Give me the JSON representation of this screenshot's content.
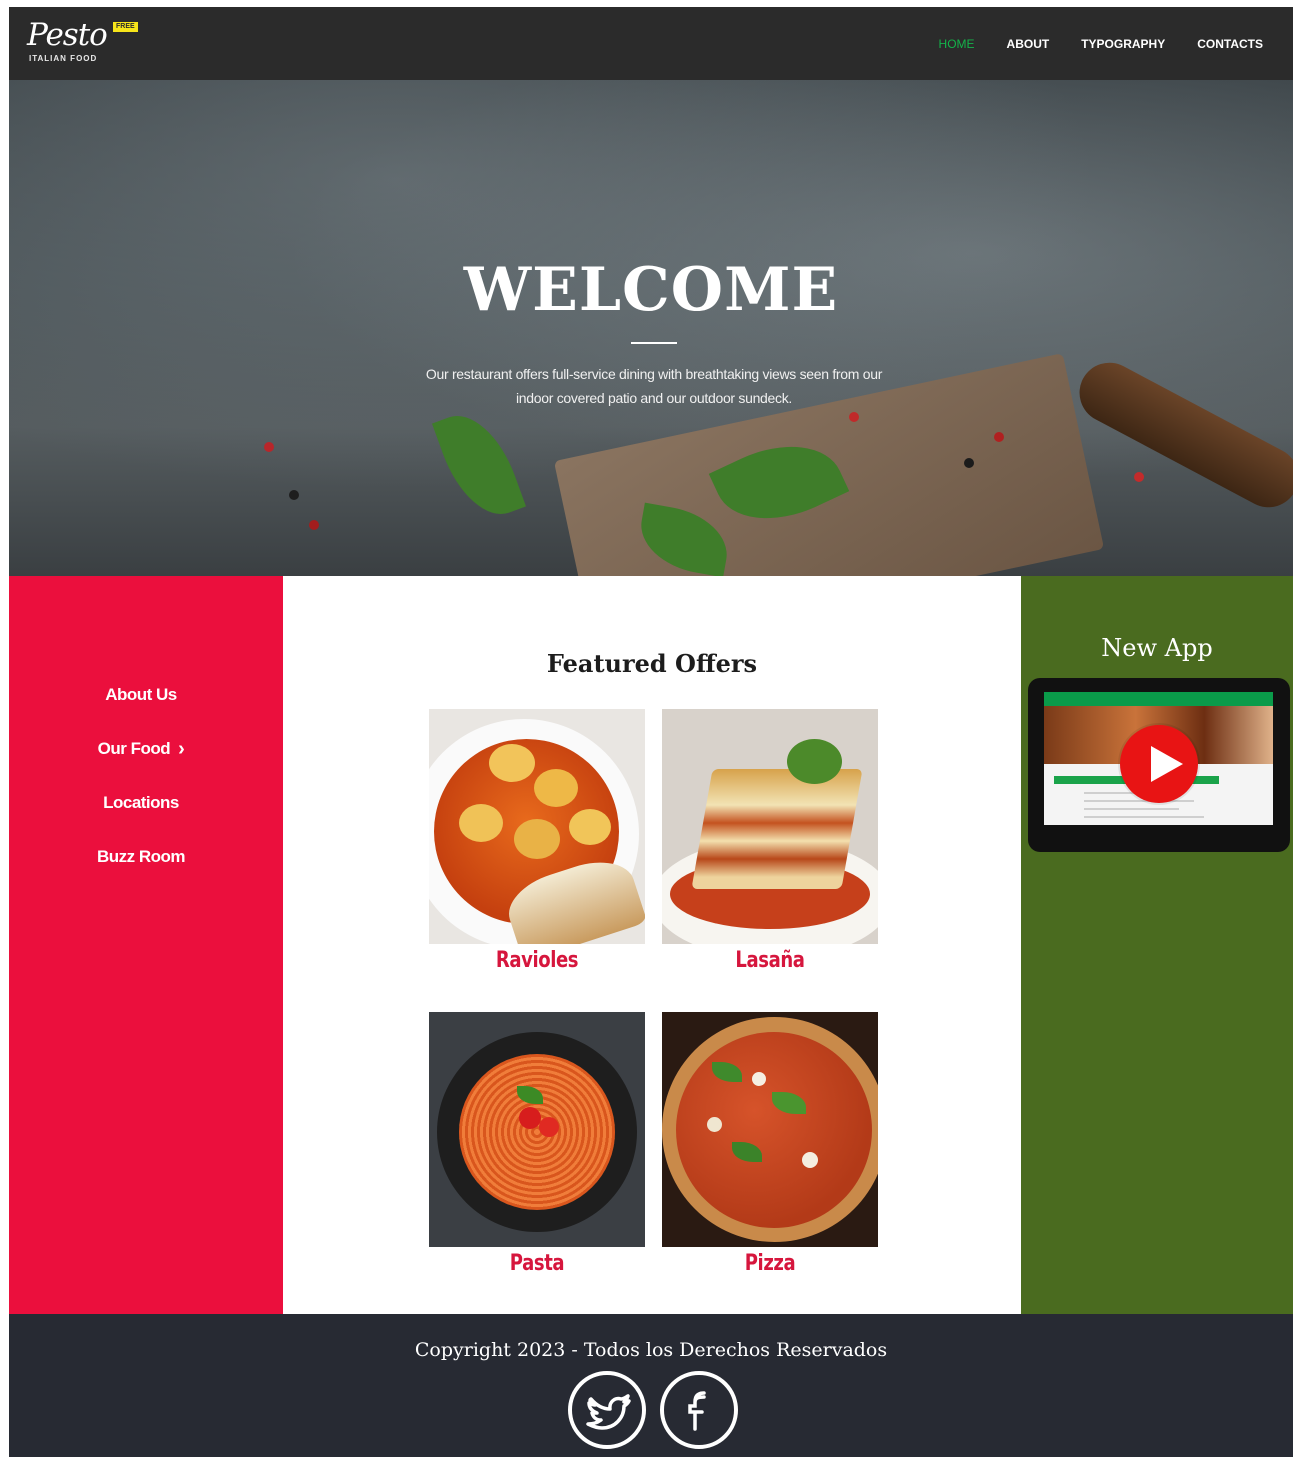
{
  "brand": {
    "name": "Pesto",
    "badge": "FREE",
    "tagline": "ITALIAN FOOD"
  },
  "nav": {
    "items": [
      {
        "label": "HOME",
        "active": true
      },
      {
        "label": "ABOUT",
        "active": false
      },
      {
        "label": "TYPOGRAPHY",
        "active": false
      },
      {
        "label": "CONTACTS",
        "active": false
      }
    ]
  },
  "hero": {
    "title": "WELCOME",
    "description": "Our restaurant offers full-service dining with breathtaking views seen from our indoor covered patio and our outdoor sundeck."
  },
  "sidebar": {
    "items": [
      {
        "label": "About Us"
      },
      {
        "label": "Our Food"
      },
      {
        "label": "Locations"
      },
      {
        "label": "Buzz Room"
      }
    ],
    "expand_icon": "chevron-right-icon"
  },
  "featured": {
    "title": "Featured Offers",
    "offers": [
      {
        "name": "Ravioles"
      },
      {
        "name": "Lasaña"
      },
      {
        "name": "Pasta"
      },
      {
        "name": "Pizza"
      }
    ]
  },
  "app_panel": {
    "title": "New App",
    "video_icon": "play-icon"
  },
  "footer": {
    "copyright": "Copyright 2023 - Todos los Derechos Reservados",
    "social": [
      {
        "icon": "twitter-icon"
      },
      {
        "icon": "facebook-icon"
      }
    ]
  },
  "colors": {
    "nav_bg": "#2b2b2b",
    "nav_active": "#14b34a",
    "sidebar_bg": "#eb0f3d",
    "offer_name": "#d6163d",
    "app_panel_bg": "#4a6b1f",
    "footer_bg": "#272a33",
    "badge": "#f7e51a"
  }
}
